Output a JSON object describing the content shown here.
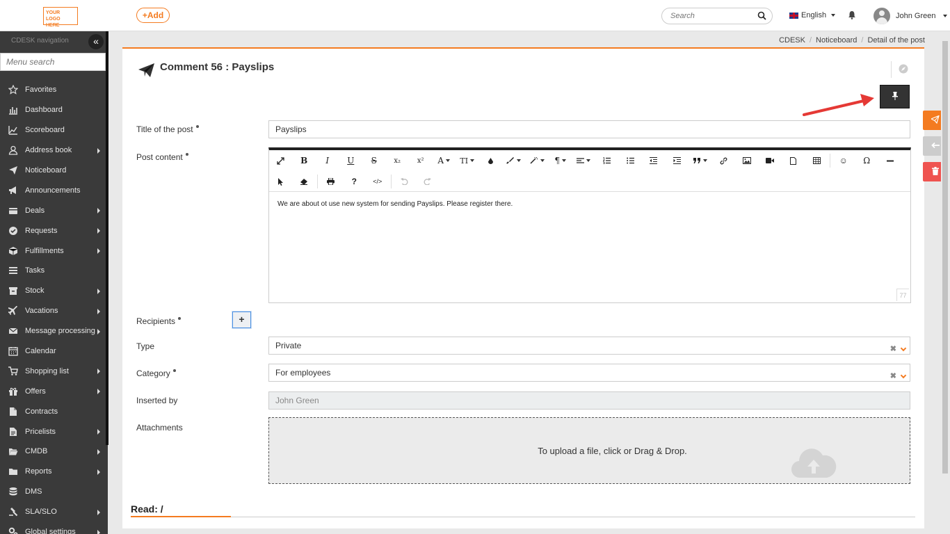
{
  "header": {
    "logo_line1": "YOUR LOGO",
    "logo_line2": "HERE",
    "add_label": "+Add",
    "search_placeholder": "Search",
    "language": "English",
    "user_name": "John Green"
  },
  "sidebar": {
    "title": "CDESK navigation",
    "collapse_glyph": "«",
    "search_placeholder": "Menu search",
    "items": [
      {
        "label": "Favorites",
        "icon": "star-icon",
        "submenu": false
      },
      {
        "label": "Dashboard",
        "icon": "bar-chart-icon",
        "submenu": false
      },
      {
        "label": "Scoreboard",
        "icon": "line-chart-icon",
        "submenu": false
      },
      {
        "label": "Address book",
        "icon": "user-icon",
        "submenu": true
      },
      {
        "label": "Noticeboard",
        "icon": "paper-plane-icon",
        "submenu": false
      },
      {
        "label": "Announcements",
        "icon": "bullhorn-icon",
        "submenu": false
      },
      {
        "label": "Deals",
        "icon": "credit-card-icon",
        "submenu": true
      },
      {
        "label": "Requests",
        "icon": "check-circle-icon",
        "submenu": true
      },
      {
        "label": "Fulfillments",
        "icon": "cube-icon",
        "submenu": true
      },
      {
        "label": "Tasks",
        "icon": "tasks-icon",
        "submenu": false
      },
      {
        "label": "Stock",
        "icon": "archive-icon",
        "submenu": true
      },
      {
        "label": "Vacations",
        "icon": "plane-icon",
        "submenu": true
      },
      {
        "label": "Message processing",
        "icon": "envelope-icon",
        "submenu": true
      },
      {
        "label": "Calendar",
        "icon": "calendar-icon",
        "submenu": false
      },
      {
        "label": "Shopping list",
        "icon": "cart-icon",
        "submenu": true
      },
      {
        "label": "Offers",
        "icon": "gift-icon",
        "submenu": true
      },
      {
        "label": "Contracts",
        "icon": "file-icon",
        "submenu": false
      },
      {
        "label": "Pricelists",
        "icon": "document-icon",
        "submenu": true
      },
      {
        "label": "CMDB",
        "icon": "folder-open-icon",
        "submenu": true
      },
      {
        "label": "Reports",
        "icon": "folder-icon",
        "submenu": true
      },
      {
        "label": "DMS",
        "icon": "database-icon",
        "submenu": false
      },
      {
        "label": "SLA/SLO",
        "icon": "gavel-icon",
        "submenu": true
      },
      {
        "label": "Global settings",
        "icon": "cogs-icon",
        "submenu": true
      }
    ]
  },
  "breadcrumb": {
    "items": [
      "CDESK",
      "Noticeboard",
      "Detail of the post"
    ]
  },
  "page": {
    "title": "Comment 56 : Payslips"
  },
  "form": {
    "title_label": "Title of the post",
    "title_value": "Payslips",
    "content_label": "Post content",
    "content_value": "We are about ot use new system for sending Payslips. Please register there.",
    "resize_mark": "77",
    "recipients_label": "Recipients",
    "add_recipient": "+",
    "type_label": "Type",
    "type_value": "Private",
    "category_label": "Category",
    "category_value": "For employees",
    "inserted_by_label": "Inserted by",
    "inserted_by_value": "John Green",
    "attachments_label": "Attachments",
    "dropzone_text": "To upload a file, click or Drag & Drop.",
    "clear_glyph": "✖"
  },
  "editor_toolbar": {
    "bold": "B",
    "italic": "I",
    "underline": "U",
    "strike": "S",
    "subscript": "x₂",
    "superscript": "x²",
    "font": "A",
    "font_size": "TI",
    "paragraph": "¶",
    "help": "?",
    "code": "</>",
    "emoji": "☺",
    "special_char": "Ω"
  },
  "read_section": {
    "label": "Read: /"
  },
  "colors": {
    "accent": "#f47b20",
    "sidebar_bg": "#3a3a3a",
    "danger": "#ef5350"
  }
}
